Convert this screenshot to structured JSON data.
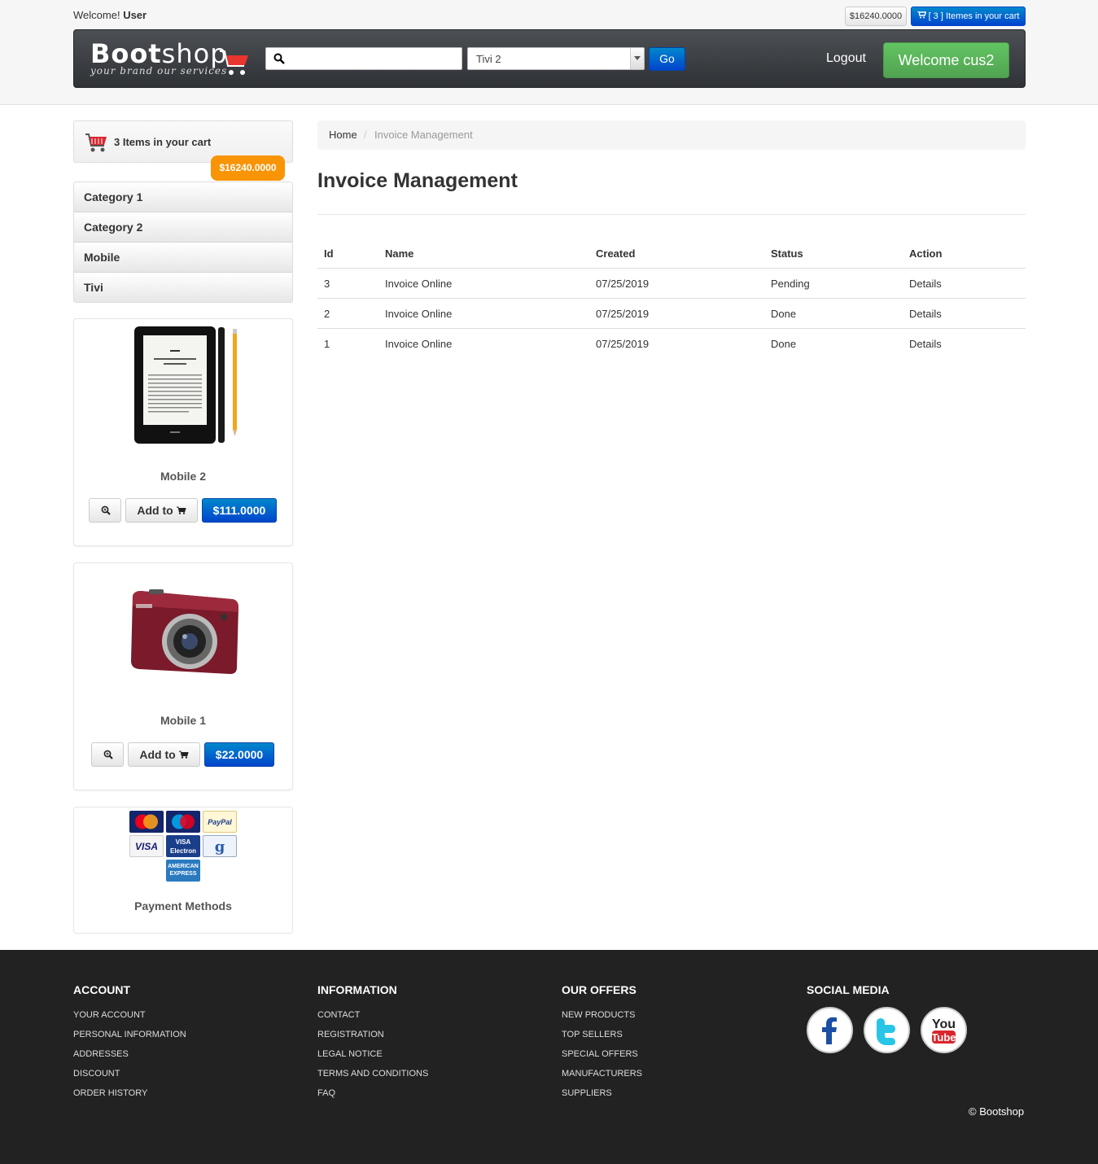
{
  "header": {
    "welcome_prefix": "Welcome!",
    "welcome_user": "User",
    "cart_total": "$16240.0000",
    "cart_button": "[ 3 ] Itemes in your cart",
    "logo_main_bold": "Boot",
    "logo_main_rest": "shop",
    "logo_tagline": "your brand our services",
    "search_value": "",
    "select_value": "Tivi 2",
    "go_label": "Go",
    "logout_label": "Logout",
    "welcome_button": "Welcome cus2"
  },
  "sidebar": {
    "cart_text": "3 Items in your cart",
    "cart_amount": "$16240.0000",
    "categories": [
      "Category 1",
      "Category 2",
      "Mobile",
      "Tivi"
    ],
    "products": [
      {
        "name": "Mobile 2",
        "add_label": "Add to",
        "price": "$111.0000"
      },
      {
        "name": "Mobile 1",
        "add_label": "Add to",
        "price": "$22.0000"
      }
    ],
    "payment_label": "Payment Methods",
    "payment_cards": [
      "MasterCard",
      "Maestro",
      "PayPal",
      "VISA",
      "VISA Electron",
      "Google",
      "American Express"
    ]
  },
  "breadcrumb": {
    "home": "Home",
    "separator": "/",
    "current": "Invoice Management"
  },
  "page_title": "Invoice Management",
  "table": {
    "headers": [
      "Id",
      "Name",
      "Created",
      "Status",
      "Action"
    ],
    "rows": [
      [
        "3",
        "Invoice Online",
        "07/25/2019",
        "Pending",
        "Details"
      ],
      [
        "2",
        "Invoice Online",
        "07/25/2019",
        "Done",
        "Details"
      ],
      [
        "1",
        "Invoice Online",
        "07/25/2019",
        "Done",
        "Details"
      ]
    ]
  },
  "footer": {
    "account": {
      "title": "ACCOUNT",
      "links": [
        "YOUR ACCOUNT",
        "PERSONAL INFORMATION",
        "ADDRESSES",
        "DISCOUNT",
        "ORDER HISTORY"
      ]
    },
    "information": {
      "title": "INFORMATION",
      "links": [
        "CONTACT",
        "REGISTRATION",
        "LEGAL NOTICE",
        "TERMS AND CONDITIONS",
        "FAQ"
      ]
    },
    "offers": {
      "title": "OUR OFFERS",
      "links": [
        "NEW PRODUCTS",
        "TOP SELLERS",
        "SPECIAL OFFERS",
        "MANUFACTURERS",
        "SUPPLIERS"
      ]
    },
    "social": {
      "title": "SOCIAL MEDIA",
      "icons": [
        "facebook-icon",
        "twitter-icon",
        "youtube-icon"
      ]
    },
    "copyright": "© Bootshop"
  },
  "colors": {
    "primary": "#0044cc",
    "success": "#51a351",
    "warning": "#f89406",
    "footer_bg": "#222222"
  }
}
